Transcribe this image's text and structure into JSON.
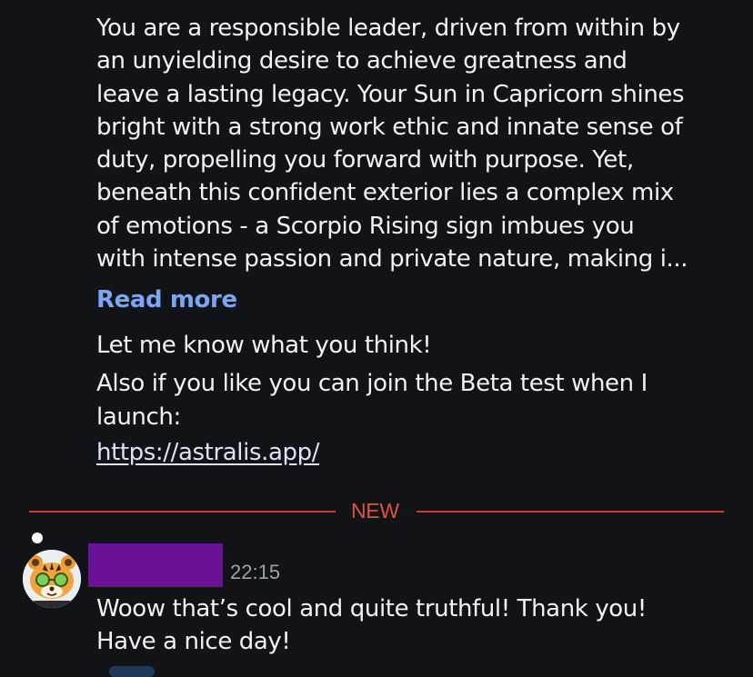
{
  "message": {
    "paragraph_lines": [
      "You are a responsible leader, driven from within by",
      "an unyielding desire to achieve greatness and",
      "leave a lasting legacy. Your Sun in Capricorn shines",
      "bright with a strong work ethic and innate sense of",
      "duty, propelling you forward with purpose. Yet,",
      "beneath this confident exterior lies a complex mix",
      "of emotions - a Scorpio Rising sign imbues you",
      "with intense passion and private nature, making i..."
    ],
    "read_more": "Read more",
    "feedback": "Let me know what you think!",
    "beta_line": "Also if you like you can join the Beta test when I",
    "launch_line": "launch:",
    "link": "https://astralis.app/"
  },
  "divider": {
    "label": "NEW",
    "color": "#c8412f"
  },
  "reply": {
    "avatar_icon": "tiger-avatar-icon",
    "username_redacted_color": "#6a1295",
    "timestamp": "22:15",
    "line1": "Woow that’s cool and quite truthful! Thank you!",
    "line2": "Have a nice day!"
  },
  "colors": {
    "background": "#111316",
    "text": "#f1f2f4",
    "link_accent": "#7aa6f5",
    "new_accent": "#e0533b"
  }
}
